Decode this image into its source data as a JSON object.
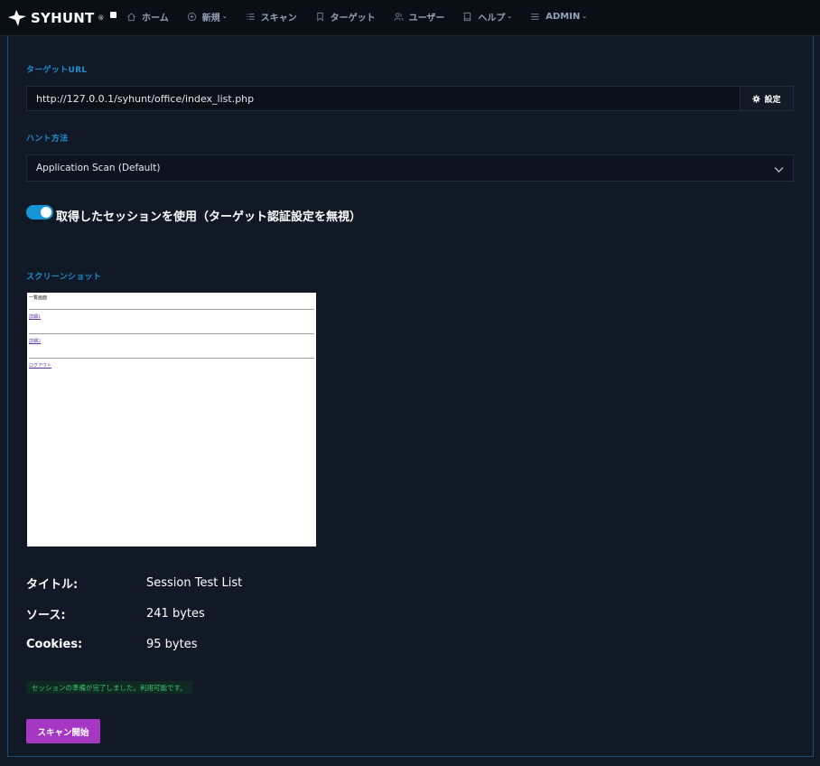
{
  "brand": {
    "name": "SYHUNT",
    "trademark": "®"
  },
  "nav": {
    "items": [
      {
        "label": "ホーム",
        "icon": "home-icon",
        "caret": ""
      },
      {
        "label": "新規",
        "icon": "plus-circle-icon",
        "caret": "⌄"
      },
      {
        "label": "スキャン",
        "icon": "list-icon",
        "caret": ""
      },
      {
        "label": "ターゲット",
        "icon": "bookmark-icon",
        "caret": ""
      },
      {
        "label": "ユーザー",
        "icon": "users-icon",
        "caret": ""
      },
      {
        "label": "ヘルプ",
        "icon": "book-icon",
        "caret": "⌄"
      },
      {
        "label": "ADMIN",
        "icon": "menu-icon",
        "caret": "⌄"
      }
    ]
  },
  "form": {
    "target_url_label": "ターゲットURL",
    "target_url_value": "http://127.0.0.1/syhunt/office/index_list.php",
    "settings_button": "設定",
    "hunt_method_label": "ハント方法",
    "hunt_method_value": "Application Scan (Default)",
    "session_toggle_label": "取得したセッションを使用（ターゲット認証設定を無視）",
    "session_toggle_on": true
  },
  "screenshot": {
    "label": "スクリーンショット",
    "page_title": "一覧画面",
    "links": [
      "詳細1",
      "詳細2",
      "ログアウト"
    ]
  },
  "info": {
    "title_key": "タイトル:",
    "title_value": "Session Test List",
    "source_key": "ソース:",
    "source_value": "241 bytes",
    "cookies_key": "Cookies:",
    "cookies_value": "95 bytes"
  },
  "status_message": "セッションの準備が完了しました。利用可能です。",
  "scan_button": "スキャン開始",
  "colors": {
    "accent_blue": "#1695d6",
    "label_blue": "#1a8fd0",
    "scan_purple": "#a537c2",
    "success_green": "#3cc56a",
    "background": "#111826"
  }
}
